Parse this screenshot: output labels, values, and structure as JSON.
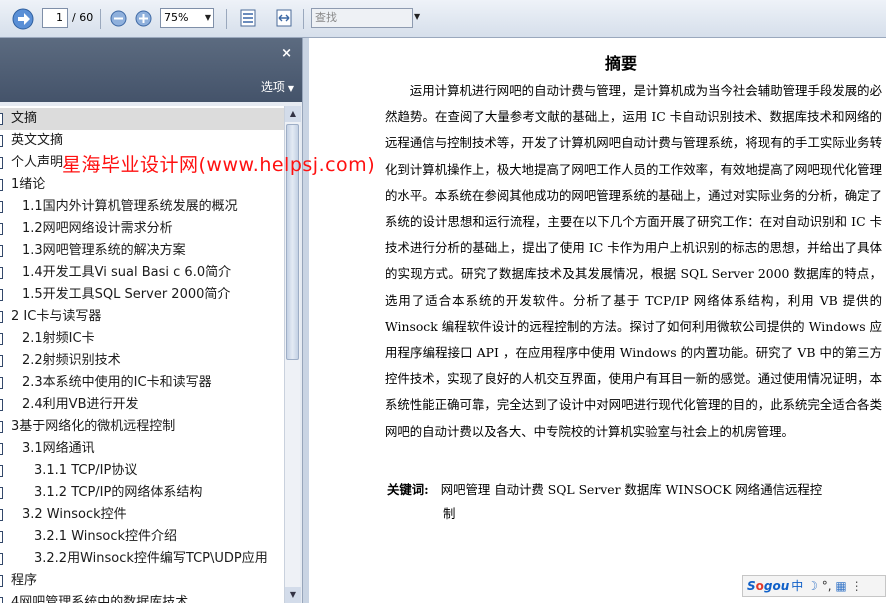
{
  "toolbar": {
    "current_page": "1",
    "total_pages": "/ 60",
    "zoom": "75%",
    "search_placeholder": "查找"
  },
  "sidebar": {
    "options_label": "选项",
    "outline": [
      {
        "label": "文摘",
        "indent": 0,
        "selected": true
      },
      {
        "label": "英文文摘",
        "indent": 0
      },
      {
        "label": "个人声明",
        "indent": 0
      },
      {
        "label": "1绪论",
        "indent": 0
      },
      {
        "label": "1.1国内外计算机管理系统发展的概况",
        "indent": 1
      },
      {
        "label": "1.2网吧网络设计需求分析",
        "indent": 1
      },
      {
        "label": "1.3网吧管理系统的解决方案",
        "indent": 1
      },
      {
        "label": "1.4开发工具Vi sual Basi c 6.0简介",
        "indent": 1
      },
      {
        "label": "1.5开发工具SQL Server 2000简介",
        "indent": 1
      },
      {
        "label": "2 IC卡与读写器",
        "indent": 0
      },
      {
        "label": "2.1射频IC卡",
        "indent": 1
      },
      {
        "label": "2.2射频识别技术",
        "indent": 1
      },
      {
        "label": "2.3本系统中使用的IC卡和读写器",
        "indent": 1
      },
      {
        "label": "2.4利用VB进行开发",
        "indent": 1
      },
      {
        "label": "3基于网络化的微机远程控制",
        "indent": 0
      },
      {
        "label": "3.1网络通讯",
        "indent": 1
      },
      {
        "label": "3.1.1 TCP/IP协议",
        "indent": 2
      },
      {
        "label": "3.1.2 TCP/IP的网络体系结构",
        "indent": 2
      },
      {
        "label": "3.2 Winsock控件",
        "indent": 1
      },
      {
        "label": "3.2.1 Winsock控件介绍",
        "indent": 2
      },
      {
        "label": "3.2.2用Winsock控件编写TCP\\UDP应用",
        "indent": 2
      },
      {
        "label": "程序",
        "indent": 0
      },
      {
        "label": "4网吧管理系统中的数据库技术",
        "indent": 0
      }
    ]
  },
  "document": {
    "title": "摘要",
    "paragraph": "运用计算机进行网吧的自动计费与管理，是计算机成为当今社会辅助管理手段发展的必然趋势。在查阅了大量参考文献的基础上，运用 IC 卡自动识别技术、数据库技术和网络的远程通信与控制技术等，开发了计算机网吧自动计费与管理系统，将现有的手工实际业务转化到计算机操作上，极大地提高了网吧工作人员的工作效率，有效地提高了网吧现代化管理的水平。本系统在参阅其他成功的网吧管理系统的基础上，通过对实际业务的分析，确定了系统的设计思想和运行流程，主要在以下几个方面开展了研究工作：在对自动识别和 IC 卡技术进行分析的基础上，提出了使用 IC 卡作为用户上机识别的标志的思想，并给出了具体的实现方式。研究了数据库技术及其发展情况，根据 SQL Server 2000 数据库的特点，选用了适合本系统的开发软件。分析了基于 TCP/IP 网络体系结构，利用 VB 提供的 Winsock 编程软件设计的远程控制的方法。探讨了如何利用微软公司提供的 Windows 应用程序编程接口 API ，在应用程序中使用 Windows 的内置功能。研究了 VB 中的第三方控件技术，实现了良好的人机交互界面，使用户有耳目一新的感觉。通过使用情况证明，本系统性能正确可靠，完全达到了设计中对网吧进行现代化管理的目的，此系统完全适合各类网吧的自动计费以及各大、中专院校的计算机实验室与社会上的机房管理。",
    "keywords_label": "关键词:",
    "keywords": "网吧管理   自动计费   SQL Server 数据库    WINSOCK 网络通信远程控",
    "keywords_tail": "制"
  },
  "watermark": "星海毕业设计网(www.helpsj.com)",
  "ime": {
    "brand_s": "S",
    "brand_o": "o",
    "brand_rest": "gou",
    "mode": "中"
  },
  "colors": {
    "sidebar_header": "#4a5a70",
    "watermark": "#ff1010"
  }
}
